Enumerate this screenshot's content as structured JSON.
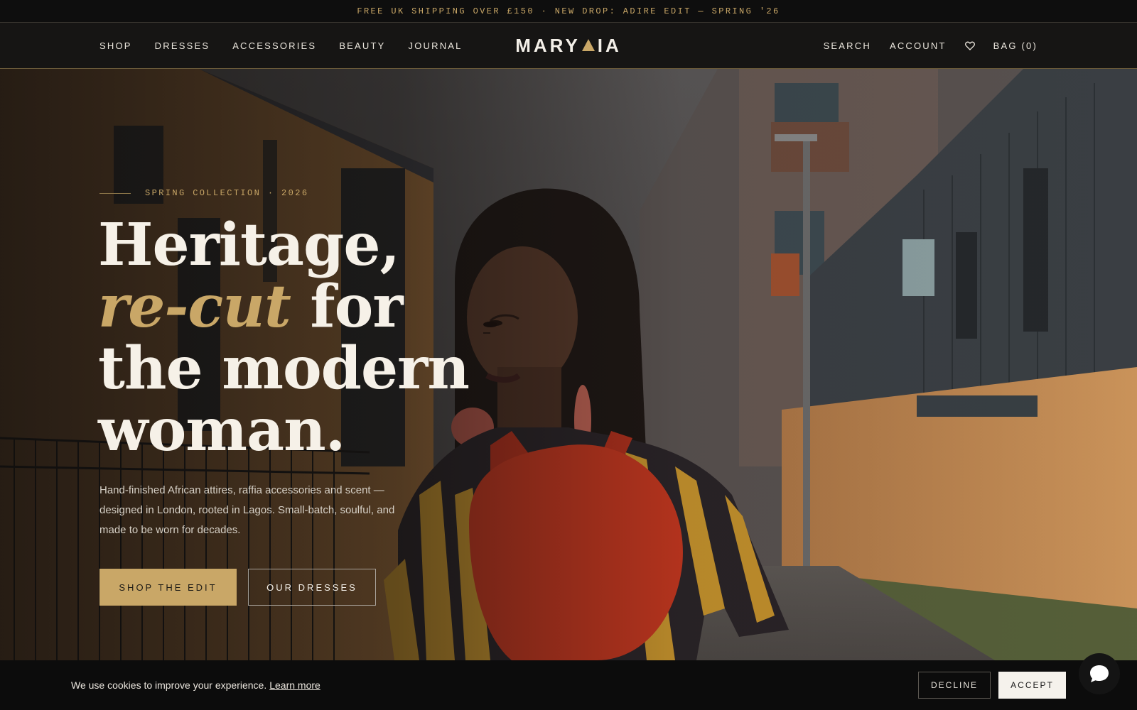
{
  "announcement": {
    "text": "FREE UK SHIPPING OVER £150 · NEW DROP: ADIRE EDIT — SPRING '26"
  },
  "header": {
    "nav_left": [
      "SHOP",
      "DRESSES",
      "ACCESSORIES",
      "BEAUTY",
      "JOURNAL"
    ],
    "logo": {
      "left": "MARY",
      "right": "IA"
    },
    "nav_right": {
      "search": "SEARCH",
      "account": "ACCOUNT",
      "bag": "BAG (0)"
    }
  },
  "hero": {
    "eyebrow": "SPRING COLLECTION · 2026",
    "headline": {
      "line1": "Heritage,",
      "line2_accent": "re-cut",
      "line2_rest": " for",
      "line3": "the modern",
      "line4": "woman."
    },
    "subtext": "Hand-finished African attires, raffia accessories and scent — designed in London, rooted in Lagos. Small-batch, soulful, and made to be worn for decades.",
    "primary_cta": "SHOP THE EDIT",
    "secondary_cta": "OUR DRESSES"
  },
  "cookie": {
    "text": "We use cookies to improve your experience.",
    "learn_more": "Learn more",
    "decline": "DECLINE",
    "accept": "ACCEPT"
  },
  "colors": {
    "accent_gold": "#c9a767",
    "dark": "#111111",
    "cream": "#f3efe8"
  },
  "icons": {
    "wishlist": "heart-icon",
    "chat": "chat-bubble-icon",
    "logo_mark": "triangle-icon"
  }
}
